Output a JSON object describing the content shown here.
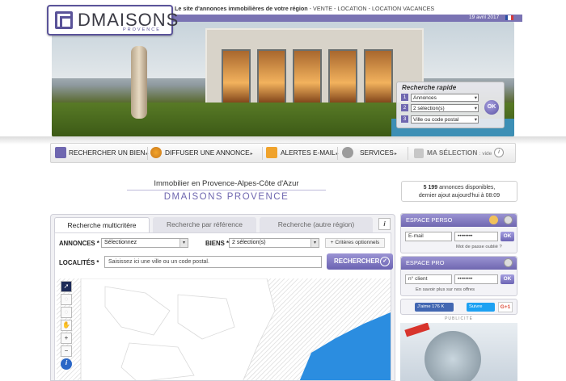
{
  "brand": {
    "name": "DMAISONS",
    "sub": "PROVENCE"
  },
  "topbar": {
    "tagline": "Le site d'annonces immobilières de votre région",
    "links": "- VENTE - LOCATION - LOCATION VACANCES",
    "date": "19 avril 2017"
  },
  "quick_search": {
    "title": "Recherche rapide",
    "rows": [
      {
        "num": "1",
        "value": "Annonces"
      },
      {
        "num": "2",
        "value": "2 sélection(s)"
      },
      {
        "num": "3",
        "value": "Ville ou code postal"
      }
    ],
    "ok": "OK"
  },
  "nav": {
    "items": [
      {
        "label": "RECHERCHER UN BIEN"
      },
      {
        "label": "DIFFUSER UNE ANNONCE"
      },
      {
        "label": "ALERTES E-MAIL"
      },
      {
        "label": "SERVICES"
      }
    ],
    "selection_label": "MA SÉLECTION",
    "selection_state": ": vide"
  },
  "heading": {
    "title": "Immobilier en Provence-Alpes-Côte d'Azur",
    "brand": "DMAISONS PROVENCE"
  },
  "stats": {
    "count": "5 199",
    "line1_rest": "annonces disponibles,",
    "line2": "dernier ajout aujourd'hui à 08:09"
  },
  "search": {
    "tabs": [
      "Recherche multicritère",
      "Recherche par référence",
      "Recherche (autre région)"
    ],
    "info": "i",
    "annonces_label": "ANNONCES *",
    "annonces_value": "Sélectionnez",
    "biens_label": "BIENS *",
    "biens_value": "2 sélection(s)",
    "criteres": "Critères optionnels",
    "localites_label": "LOCALITÉS *",
    "localites_placeholder": "Saisissez ici une ville ou un code postal.",
    "submit": "RECHERCHER"
  },
  "espace_perso": {
    "title": "ESPACE PERSO",
    "email_placeholder": "E-mail",
    "password": "••••••••",
    "ok": "OK",
    "forgot": "Mot de passe oublié ?"
  },
  "espace_pro": {
    "title": "ESPACE PRO",
    "client_placeholder": "n° client",
    "password": "••••••••",
    "ok": "OK",
    "more": "En savoir plus sur nos offres"
  },
  "social": {
    "fb": "J'aime 176 K",
    "tw": "Suivre",
    "gp": "G+1"
  },
  "pub": "PUBLICITÉ",
  "colors": {
    "brand": "#6f67b0",
    "nav_bg": "#efefef"
  }
}
